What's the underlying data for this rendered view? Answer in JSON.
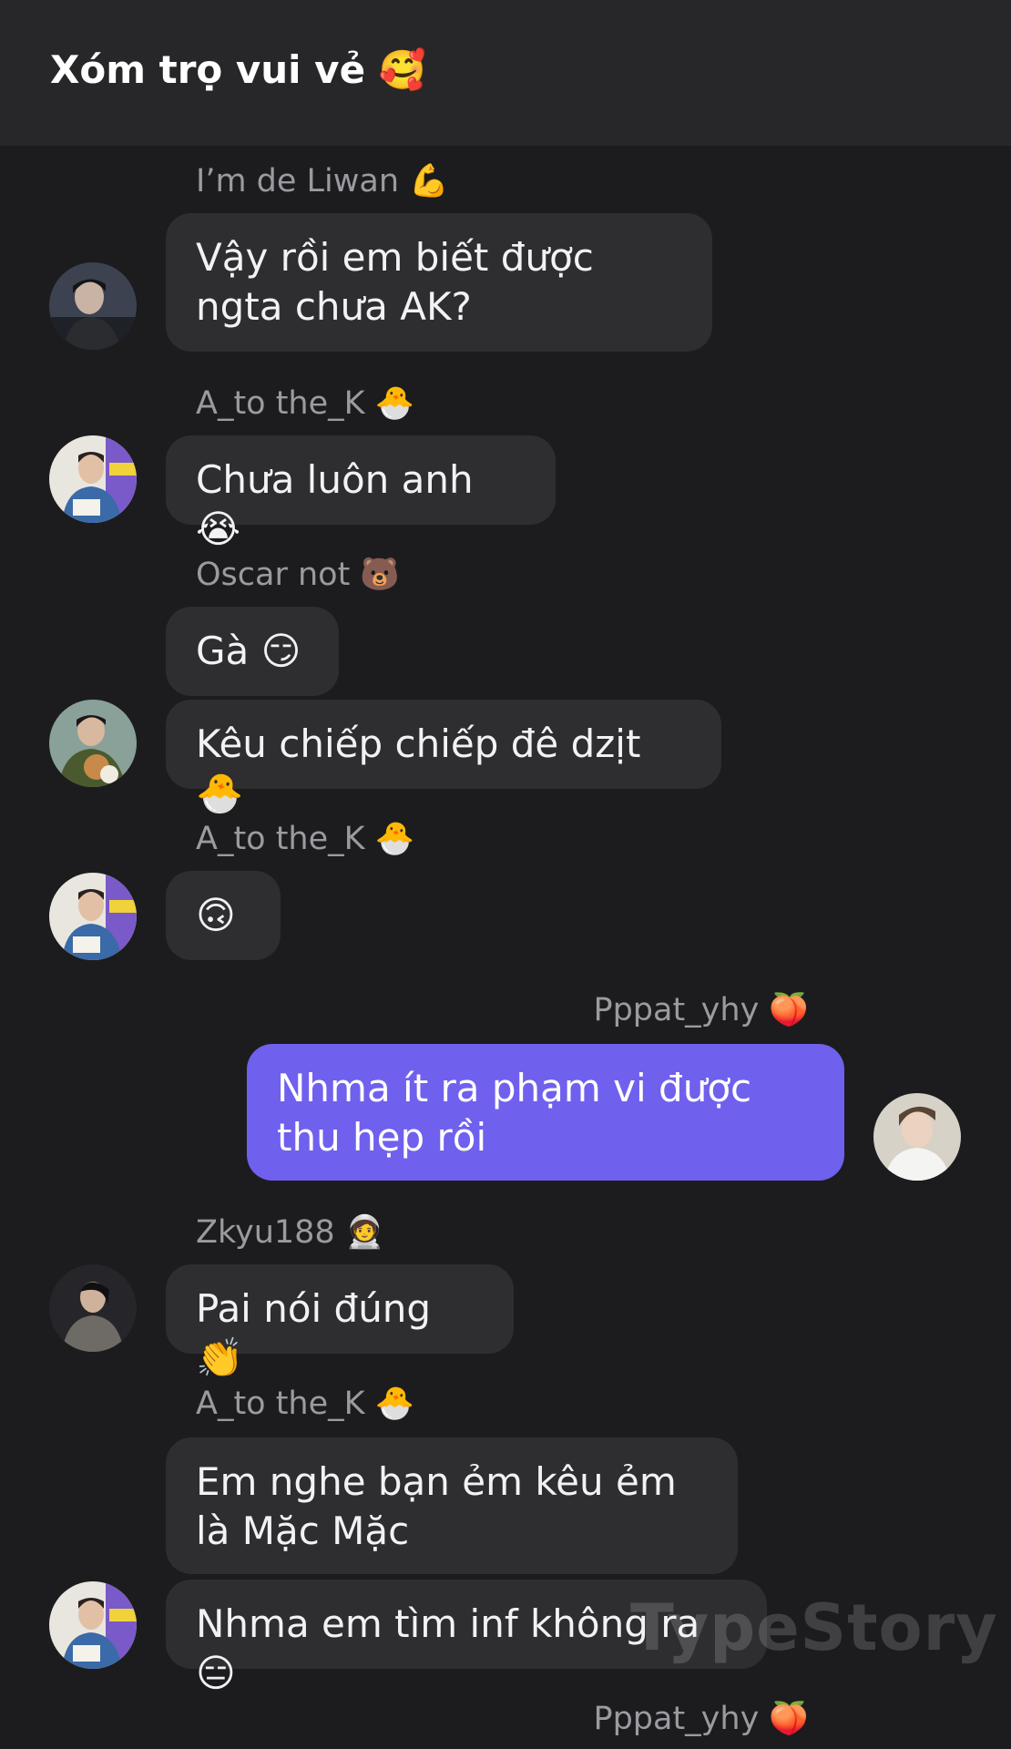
{
  "header": {
    "title": "Xóm trọ vui vẻ 🥰"
  },
  "messages": [
    {
      "sender": "I’m de Liwan 💪",
      "text": "Vậy rồi em biết được ngta chưa AK?"
    },
    {
      "sender": "A_to the_K 🐣",
      "text": "Chưa luôn anh 😭"
    },
    {
      "sender": "Oscar not 🐻",
      "text": "Gà 😏"
    },
    {
      "sender": "",
      "text": "Kêu chiếp chiếp đê dzịt 🐣"
    },
    {
      "sender": "A_to the_K 🐣",
      "text": "🙃"
    },
    {
      "sender": "Pppat_yhy 🍑",
      "text": "Nhma ít ra phạm vi được thu hẹp rồi"
    },
    {
      "sender": "Zkyu188 🧑‍🚀",
      "text": "Pai nói đúng 👏"
    },
    {
      "sender": "A_to the_K 🐣",
      "text": "Em nghe bạn ẻm kêu ẻm là Mặc Mặc"
    },
    {
      "sender": "",
      "text": "Nhma em tìm inf không ra 😑"
    },
    {
      "sender": "Pppat_yhy 🍑",
      "text": ""
    }
  ],
  "watermark": "TypeStory",
  "colors": {
    "background": "#1c1c1e",
    "header": "#272729",
    "bubble": "#2e2e31",
    "my_bubble": "#7060ee",
    "sender_name": "#9a9aa0"
  }
}
